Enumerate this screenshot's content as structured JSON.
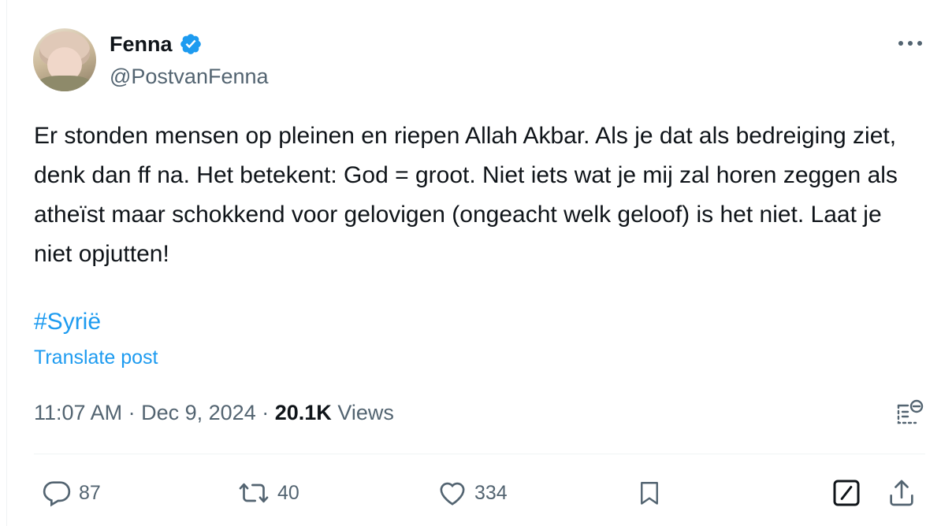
{
  "author": {
    "name": "Fenna",
    "handle": "@PostvanFenna",
    "verified": true,
    "avatar_icon": "profile-photo"
  },
  "post": {
    "text": "Er stonden mensen op pleinen en riepen Allah Akbar. Als je dat als bedreiging ziet, denk dan ff na. Het betekent: God = groot. Niet iets wat je mij zal horen zeggen als atheïst maar schokkend voor gelovigen (ongeacht welk geloof) is het niet. Laat je niet opjutten!",
    "hashtag": "#Syrië",
    "translate_label": "Translate post"
  },
  "meta": {
    "time": "11:07 AM",
    "separator": "·",
    "date": "Dec 9, 2024",
    "views_count": "20.1K",
    "views_label": "Views"
  },
  "actions": {
    "replies": "87",
    "reposts": "40",
    "likes": "334"
  },
  "colors": {
    "accent": "#1d9bf0",
    "secondary_text": "#536471",
    "primary_text": "#0f1419",
    "divider": "#eff3f4"
  },
  "icons": [
    "verified-badge-icon",
    "more-icon",
    "grok-icon",
    "reply-icon",
    "repost-icon",
    "like-icon",
    "bookmark-icon",
    "edit-icon",
    "share-icon"
  ]
}
